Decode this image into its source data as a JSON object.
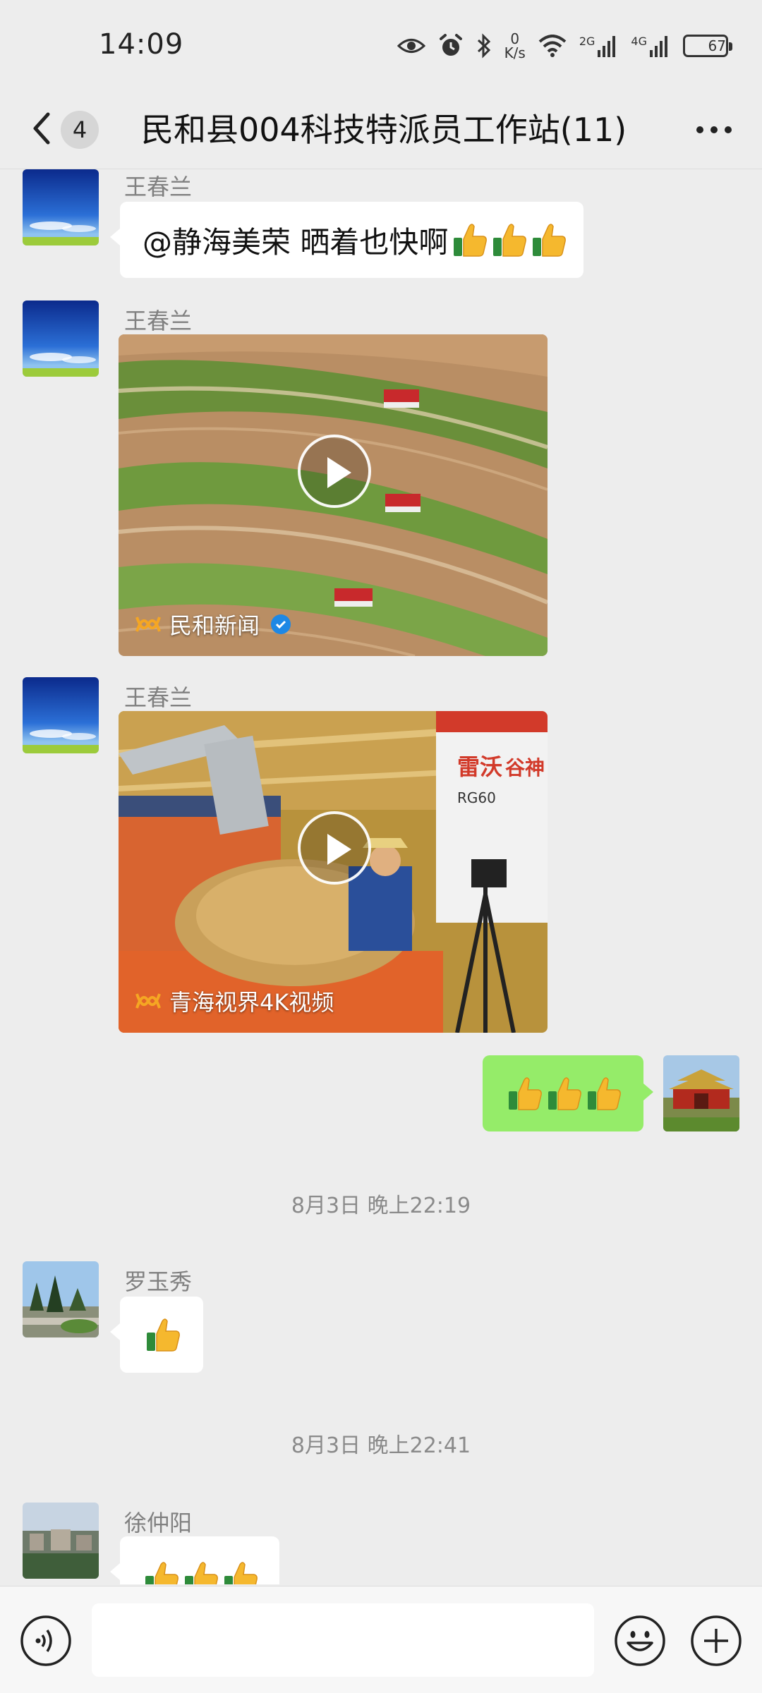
{
  "status_bar": {
    "time": "14:09",
    "net_speed_value": "0",
    "net_speed_unit": "K/s",
    "signal1_label": "2G",
    "signal2_label": "4G",
    "battery": "67",
    "battery_level": 0.67
  },
  "header": {
    "unread_count": "4",
    "title": "民和县004科技特派员工作站(11)",
    "more_icon": "more-dots-icon",
    "back_icon": "chevron-left-icon"
  },
  "messages": [
    {
      "type": "text",
      "sender": "王春兰",
      "text": "@静海美荣  晒着也快啊",
      "emoji": "thumbs-up",
      "emoji_count": 3
    },
    {
      "type": "video",
      "sender": "王春兰",
      "channel": "民和新闻",
      "verified": true
    },
    {
      "type": "video",
      "sender": "王春兰",
      "channel": "青海视界4K视频"
    },
    {
      "type": "self",
      "emoji": "thumbs-up",
      "emoji_count": 3
    },
    {
      "type": "time",
      "text": "8月3日 晚上22:19"
    },
    {
      "type": "text",
      "sender": "罗玉秀",
      "emoji": "thumbs-up",
      "emoji_count": 1
    },
    {
      "type": "time",
      "text": "8月3日 晚上22:41"
    },
    {
      "type": "text",
      "sender": "徐仲阳",
      "emoji": "thumbs-up",
      "emoji_count": 3
    }
  ],
  "input_bar": {
    "value": "",
    "voice_icon": "voice-icon",
    "emoji_icon": "emoji-icon",
    "plus_icon": "plus-icon"
  },
  "colors": {
    "background": "#ededed",
    "self_bubble": "#95ec69",
    "other_bubble": "#ffffff",
    "verified": "#1e88e5"
  }
}
